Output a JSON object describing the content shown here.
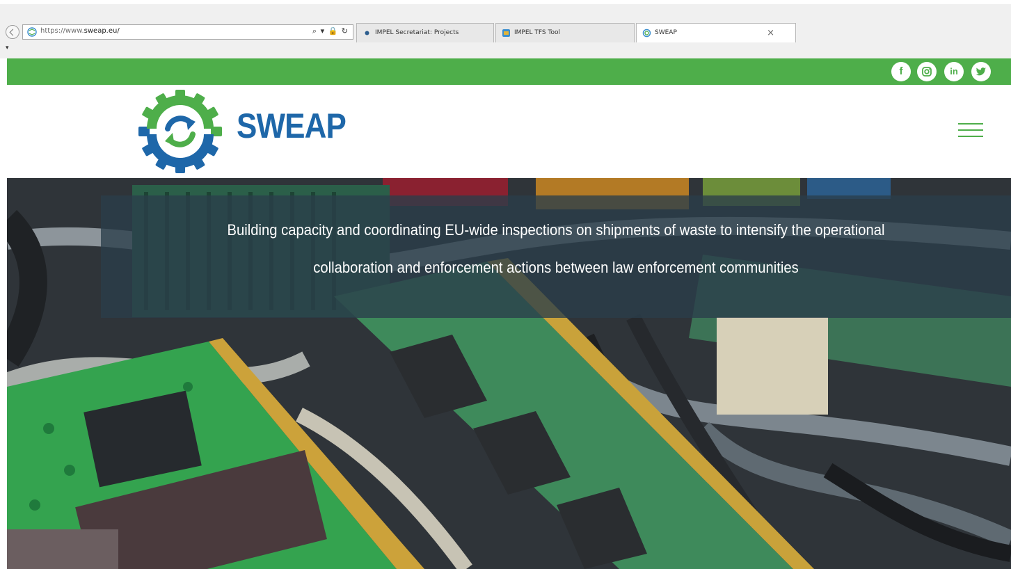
{
  "browser": {
    "url_prefix": "https://www.",
    "url_domain": "sweap.eu/",
    "address_tools": "⌕ ▾ 🔒 ↻",
    "tabs": [
      {
        "label": "IMPEL Secretariat: Projects",
        "active": false
      },
      {
        "label": "IMPEL TFS Tool",
        "active": false
      },
      {
        "label": "SWEAP",
        "active": true,
        "close": "×"
      }
    ],
    "menu_caret": "▾"
  },
  "topbar": {
    "color": "#4eae4a",
    "social": [
      {
        "icon": "facebook-icon",
        "glyph": "f"
      },
      {
        "icon": "instagram-icon",
        "glyph": ""
      },
      {
        "icon": "linkedin-icon",
        "glyph": "in"
      },
      {
        "icon": "twitter-icon",
        "glyph": ""
      }
    ]
  },
  "header": {
    "logo_text": "SWEAP",
    "brand_blue": "#1e67a9",
    "brand_green": "#4eae4a"
  },
  "hero": {
    "tagline_line1": "Building capacity and coordinating EU-wide inspections on shipments of waste to intensify the operational",
    "tagline_line2": "collaboration and enforcement actions between law enforcement communities"
  }
}
